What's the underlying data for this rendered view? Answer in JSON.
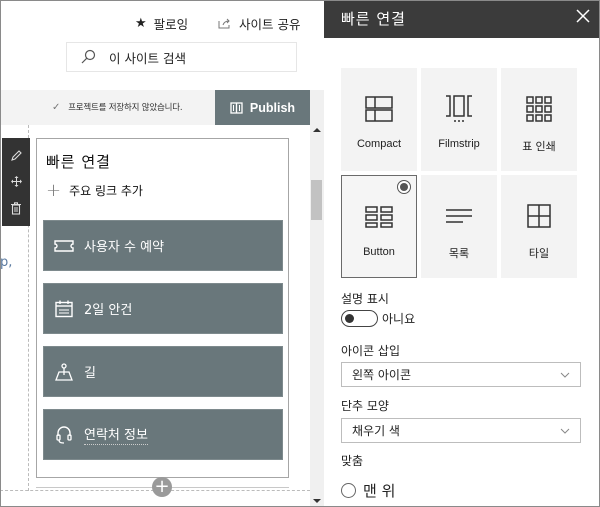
{
  "header": {
    "follow_label": "팔로잉",
    "share_label": "사이트 공유",
    "search_placeholder": "이 사이트 검색"
  },
  "command_bar": {
    "save_status": "프로젝트를 저장하지 않았습니다.",
    "publish_label": "Publish"
  },
  "canvas": {
    "stray_text": "p,",
    "webpart": {
      "title": "빠른 연결",
      "add_link_label": "주요 링크 추가",
      "links": [
        {
          "label": "사용자 수 예약",
          "icon": "ticket-icon"
        },
        {
          "label": "2일 안건",
          "icon": "calendar-icon"
        },
        {
          "label": "길",
          "icon": "map-pin-icon"
        },
        {
          "label": "연락처 정보",
          "icon": "headset-icon"
        }
      ]
    },
    "toolbox": [
      "edit-icon",
      "move-icon",
      "delete-icon"
    ]
  },
  "panel": {
    "title": "빠른 연결",
    "layouts": [
      {
        "label": "Compact",
        "icon": "compact-layout-icon",
        "selected": false
      },
      {
        "label": "Filmstrip",
        "icon": "filmstrip-layout-icon",
        "selected": false
      },
      {
        "label": "표 인쇄",
        "icon": "grid-layout-icon",
        "selected": false
      },
      {
        "label": "Button",
        "icon": "button-layout-icon",
        "selected": true
      },
      {
        "label": "목록",
        "icon": "list-layout-icon",
        "selected": false
      },
      {
        "label": "타일",
        "icon": "tiles-layout-icon",
        "selected": false
      }
    ],
    "show_description": {
      "label": "설명 표시",
      "value": "아니요",
      "on": false
    },
    "icon_insert": {
      "label": "아이콘 삽입",
      "value": "왼쪽 아이콘"
    },
    "button_shape": {
      "label": "단추 모양",
      "value": "채우기 색"
    },
    "alignment": {
      "label": "맞춤",
      "option": "맨 위"
    }
  },
  "colors": {
    "accent": "#69777b",
    "panel_header": "#3b3b3b",
    "toolbox": "#333333"
  }
}
